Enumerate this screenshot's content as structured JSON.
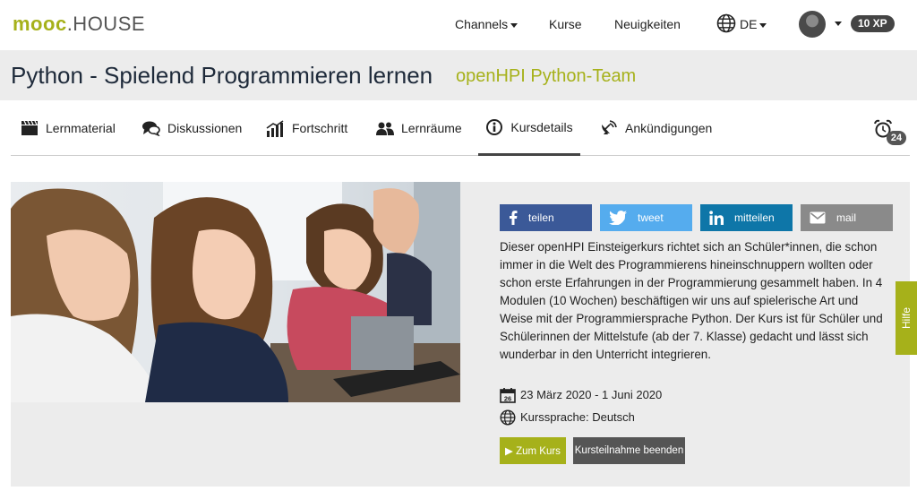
{
  "header": {
    "logo_brand": "mooc",
    "logo_house": ".HOUSE",
    "nav": {
      "channels": "Channels",
      "kurse": "Kurse",
      "neuigkeiten": "Neuigkeiten",
      "language": "DE"
    },
    "xp": "10 XP"
  },
  "course": {
    "title": "Python - Spielend Programmieren lernen",
    "team": "openHPI Python-Team"
  },
  "tabs": [
    {
      "label": "Lernmaterial",
      "icon": "clapperboard-icon"
    },
    {
      "label": "Diskussionen",
      "icon": "chat-bubbles-icon"
    },
    {
      "label": "Fortschritt",
      "icon": "progress-chart-icon"
    },
    {
      "label": "Lernräume",
      "icon": "people-icon"
    },
    {
      "label": "Kursdetails",
      "icon": "info-icon",
      "active": true
    },
    {
      "label": "Ankündigungen",
      "icon": "satellite-dish-icon"
    }
  ],
  "alarm_count": "24",
  "share": {
    "facebook": "teilen",
    "twitter": "tweet",
    "linkedin": "mitteilen",
    "mail": "mail"
  },
  "description": "Dieser openHPI Einsteigerkurs richtet sich an Schüler*innen, die schon immer in die Welt des Programmierens hineinschnuppern wollten oder schon erste Erfahrungen in der Programmierung gesammelt haben. In 4 Modulen (10 Wochen) beschäftigen wir uns auf spielerische Art und Weise mit der Programmiersprache Python. Der Kurs ist für Schüler und Schülerinnen der Mittelstufe (ab der 7. Klasse) gedacht und lässt sich wunderbar in den Unterricht integrieren.",
  "meta": {
    "calendar_day": "26",
    "dates": "23 März 2020 - 1 Juni 2020",
    "language": "Kurssprache: Deutsch"
  },
  "buttons": {
    "go": "▶ Zum Kurs",
    "end": "Kursteilnahme beenden"
  },
  "help": "Hilfe",
  "colors": {
    "accent": "#a6b11a",
    "title": "#1e2a3a",
    "facebook": "#3b5998",
    "twitter": "#55acee",
    "linkedin": "#0e76a8",
    "mail": "#8a8a8a"
  }
}
